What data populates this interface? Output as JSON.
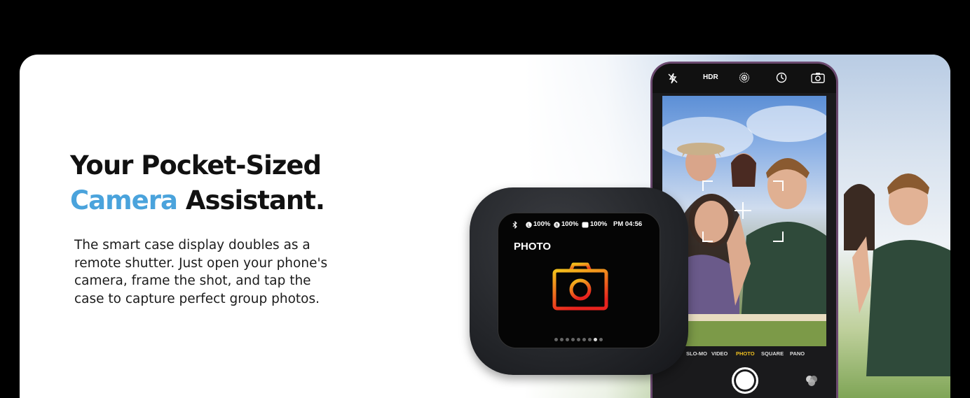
{
  "headline": {
    "line1": "Your Pocket-Sized",
    "line2_accent": "Camera",
    "line2_rest": " Assistant."
  },
  "body_copy": {
    "line1": "The smart case display doubles as a",
    "line2": "remote shutter. Just open your phone's",
    "line3": "camera, frame the shot, and tap the",
    "line4": "case to capture perfect group photos."
  },
  "phone": {
    "top_bar": {
      "hdr_label": "HDR",
      "icons": [
        "flash-off-icon",
        "live-photo-icon",
        "timer-icon",
        "camera-switch-icon"
      ]
    },
    "modes": {
      "slomo": "SLO-MO",
      "video": "VIDEO",
      "photo": "PHOTO",
      "square": "SQUARE",
      "pano": "PANO"
    }
  },
  "case_display": {
    "status": {
      "battery_left": "100%",
      "battery_right": "100%",
      "battery_case": "100%",
      "time": "PM 04:56"
    },
    "mode_label": "PHOTO",
    "page_dots_total": 9,
    "page_dots_active_index": 7
  },
  "colors": {
    "accent": "#4aa3dc",
    "camera_icon_top": "#f0c020",
    "camera_icon_bottom": "#e8231e",
    "active_mode": "#f0c020"
  }
}
